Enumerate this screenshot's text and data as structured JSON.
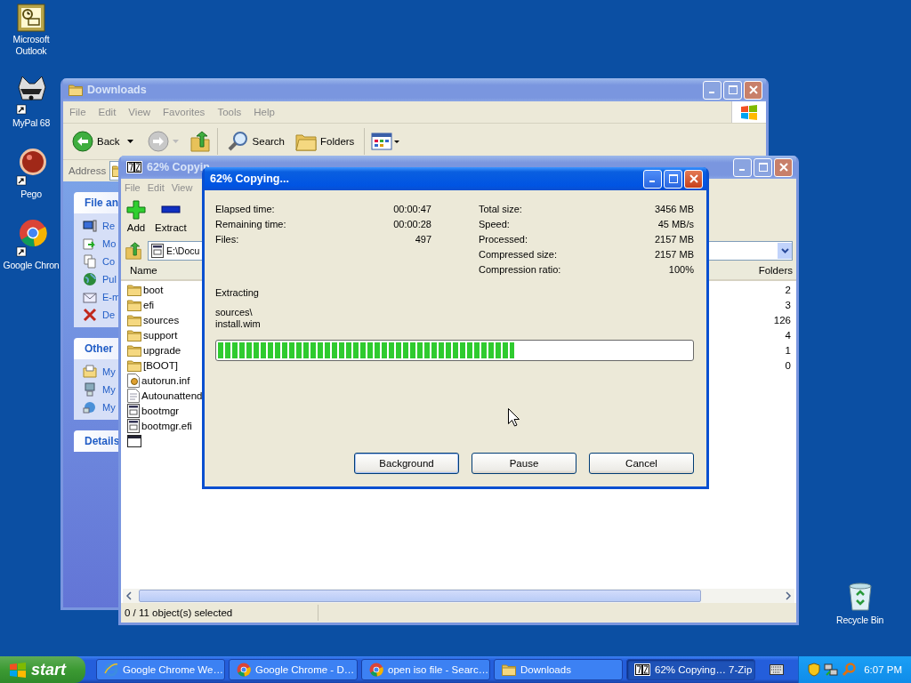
{
  "desktop_icons": [
    {
      "label": "Microsoft Outlook",
      "kind": "outlook"
    },
    {
      "label": "MyPal 68",
      "kind": "mypal"
    },
    {
      "label": "Pego",
      "kind": "pego"
    },
    {
      "label": "Google Chron",
      "kind": "chrome"
    }
  ],
  "recycle_bin": {
    "label": "Recycle Bin"
  },
  "explorer": {
    "title": "Downloads",
    "menu": [
      "File",
      "Edit",
      "View",
      "Favorites",
      "Tools",
      "Help"
    ],
    "toolbar": [
      {
        "label": "Back",
        "kind": "back"
      },
      {
        "label": "Search",
        "kind": "search"
      },
      {
        "label": "Folders",
        "kind": "folders"
      }
    ],
    "address_label": "Address",
    "task_panels": [
      {
        "title": "File an",
        "items": [
          {
            "label": "Re",
            "kind": "publish"
          },
          {
            "label": "Mo",
            "kind": "move"
          },
          {
            "label": "Co",
            "kind": "copy"
          },
          {
            "label": "Pul",
            "kind": "globe"
          },
          {
            "label": "E-m",
            "kind": "mail"
          },
          {
            "label": "De",
            "kind": "delete"
          }
        ]
      },
      {
        "title": "Other",
        "items": [
          {
            "label": "My",
            "kind": "docs"
          },
          {
            "label": "My",
            "kind": "computer"
          },
          {
            "label": "My",
            "kind": "network"
          }
        ]
      },
      {
        "title": "Details"
      }
    ]
  },
  "archive_window": {
    "title": "62% Copyin",
    "menu": [
      "File",
      "Edit",
      "View"
    ],
    "tools": [
      {
        "label": "Add",
        "kind": "add"
      },
      {
        "label": "Extract",
        "kind": "extract"
      }
    ],
    "path": "E:\\Docu",
    "columns": [
      "Name",
      "Folders"
    ],
    "rows": [
      {
        "name": "boot",
        "kind": "folder",
        "folders": "2"
      },
      {
        "name": "efi",
        "kind": "folder",
        "folders": "3"
      },
      {
        "name": "sources",
        "kind": "folder",
        "folders": "126"
      },
      {
        "name": "support",
        "kind": "folder",
        "folders": "4"
      },
      {
        "name": "upgrade",
        "kind": "folder",
        "folders": "1"
      },
      {
        "name": "[BOOT]",
        "kind": "folder",
        "folders": "0"
      },
      {
        "name": "autorun.inf",
        "kind": "settings"
      },
      {
        "name": "Autounattend",
        "kind": "xml"
      },
      {
        "name": "bootmgr",
        "kind": "system"
      },
      {
        "name": "bootmgr.efi",
        "kind": "system"
      },
      {
        "kind": "window"
      }
    ],
    "status": "0 / 11 object(s) selected"
  },
  "dialog": {
    "title": "62% Copying...",
    "left_stats": [
      {
        "label": "Elapsed time:",
        "value": "00:00:47"
      },
      {
        "label": "Remaining time:",
        "value": "00:00:28"
      },
      {
        "label": "Files:",
        "value": "497"
      }
    ],
    "right_stats": [
      {
        "label": "Total size:",
        "value": "3456 MB"
      },
      {
        "label": "Speed:",
        "value": "45 MB/s"
      },
      {
        "label": "Processed:",
        "value": "2157 MB"
      },
      {
        "label": "Compressed size:",
        "value": "2157 MB"
      },
      {
        "label": "Compression ratio:",
        "value": "100%"
      }
    ],
    "operation": "Extracting",
    "path_lines": [
      "sources\\",
      "install.wim"
    ],
    "progress": {
      "level": 0.625
    },
    "buttons": [
      "Background",
      "Pause",
      "Cancel"
    ]
  },
  "taskbar": {
    "start": "start",
    "tasks": [
      {
        "label": "Google Chrome We…",
        "kind": "ie",
        "selected": false
      },
      {
        "label": "Google Chrome - D…",
        "kind": "chrome",
        "selected": false
      },
      {
        "label": "open iso file - Searc…",
        "kind": "chrome",
        "selected": false
      },
      {
        "label": "Downloads",
        "kind": "folder",
        "selected": false
      },
      {
        "label": "62% Copying… 7-Zip",
        "kind": "sevenzip",
        "selected": true
      }
    ],
    "clock": "6:07 PM"
  }
}
